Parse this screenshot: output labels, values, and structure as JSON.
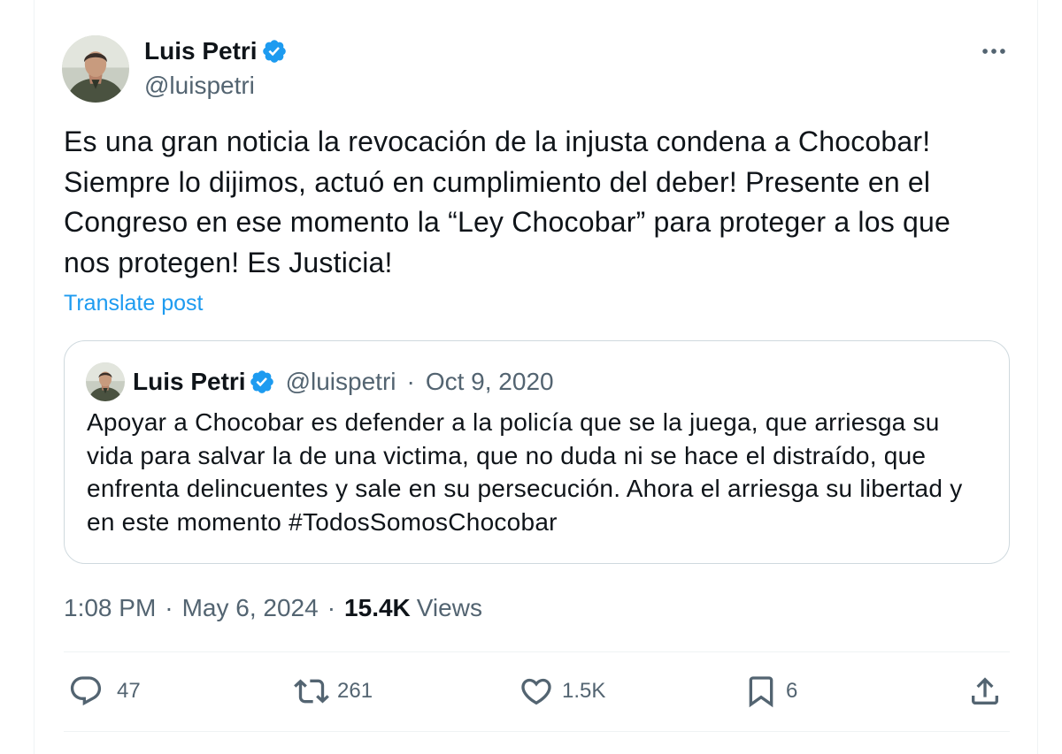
{
  "author": {
    "name": "Luis Petri",
    "handle": "@luispetri",
    "verified": true,
    "avatar_icon": "profile-photo"
  },
  "menu": {
    "icon": "more-horizontal-icon"
  },
  "post": {
    "text_lines": [
      "Es una gran noticia la revocación de la injusta condena a Chocobar!",
      "Siempre lo dijimos, actuó en cumplimiento del deber! Presente en el",
      "Congreso en ese momento la “Ley Chocobar” para proteger a los que",
      "nos protegen! Es Justicia!"
    ],
    "translate_label": "Translate post"
  },
  "quote": {
    "author_name": "Luis Petri",
    "handle": "@luispetri",
    "verified": true,
    "separator": "·",
    "date": "Oct 9, 2020",
    "avatar_icon": "profile-photo",
    "text_lines": [
      "Apoyar a Chocobar es defender a la policía que se la juega, que arriesga su",
      "vida para salvar la de una victima, que no duda ni se hace el distraído, que",
      "enfrenta delincuentes y sale en su persecución. Ahora el arriesga su libertad y",
      "en este momento #TodosSomosChocobar"
    ]
  },
  "meta": {
    "time": "1:08 PM",
    "separator": "·",
    "date": "May 6, 2024",
    "views_count": "15.4K",
    "views_label": "Views"
  },
  "actions": {
    "reply": {
      "icon": "reply-icon",
      "count": "47"
    },
    "repost": {
      "icon": "repost-icon",
      "count": "261"
    },
    "like": {
      "icon": "heart-icon",
      "count": "1.5K"
    },
    "bookmark": {
      "icon": "bookmark-icon",
      "count": "6"
    },
    "share": {
      "icon": "share-icon"
    }
  },
  "theme": {
    "text": "#0f1419",
    "secondary": "#536471",
    "link": "#1d9bf0",
    "verified": "#1d9bf0",
    "border": "#cfd9de",
    "divider": "#eff3f4"
  }
}
